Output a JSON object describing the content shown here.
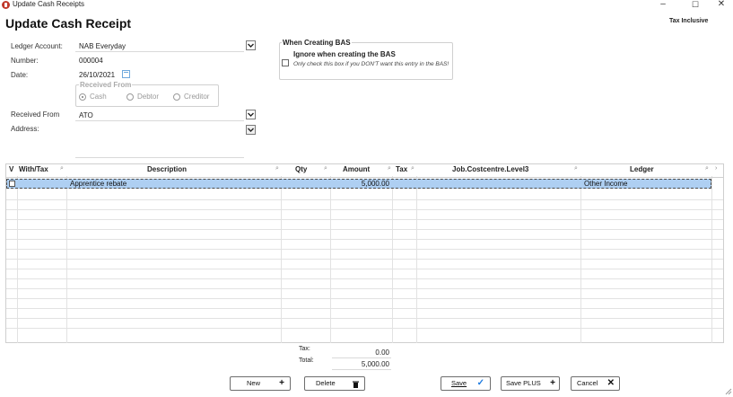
{
  "window": {
    "title": "Update Cash Receipts",
    "minimize_glyph": "–",
    "maximize_glyph": "☐",
    "close_glyph": "✕"
  },
  "page": {
    "title": "Update Cash Receipt",
    "tax_mode": "Tax Inclusive"
  },
  "form": {
    "ledger_account_label": "Ledger Account:",
    "ledger_account_value": "NAB Everyday",
    "number_label": "Number:",
    "number_value": "000004",
    "date_label": "Date:",
    "date_value": "26/10/2021",
    "received_from_group_title": "Received From",
    "received_from_options": [
      {
        "label": "Cash",
        "selected": true
      },
      {
        "label": "Debtor",
        "selected": false
      },
      {
        "label": "Creditor",
        "selected": false
      }
    ],
    "received_from_label": "Received From",
    "received_from_value": "ATO",
    "address_label": "Address:",
    "address_value": ""
  },
  "bas": {
    "group_title": "When Creating BAS",
    "checkbox_label": "Ignore when creating the BAS",
    "checked": false,
    "hint": "Only check this box if you DON'T want this entry in the BAS!"
  },
  "grid": {
    "columns": [
      "V",
      "With/Tax",
      "Description",
      "Qty",
      "Amount",
      "Tax",
      "Job.Costcentre.Level3",
      "Ledger"
    ],
    "rows": [
      {
        "v": "",
        "with_tax": "",
        "description": "Apprentice rebate",
        "qty": "",
        "amount": "5,000.00",
        "tax": "",
        "job": "",
        "ledger": "Other Income"
      }
    ]
  },
  "totals": {
    "tax_label": "Tax:",
    "tax_value": "0.00",
    "total_label": "Total:",
    "total_value": "5,000.00"
  },
  "buttons": {
    "new": "New",
    "delete": "Delete",
    "save": "Save",
    "save_plus": "Save PLUS",
    "cancel": "Cancel"
  },
  "icons": {
    "app": "app-logo-icon",
    "search": "search-icon",
    "dropdown": "chevron-down-icon",
    "calendar": "calendar-icon",
    "plus": "plus-icon",
    "trash": "trash-icon",
    "check": "check-icon",
    "close": "close-icon"
  },
  "colors": {
    "selection": "#aecff2",
    "save_check": "#1e7be0"
  }
}
